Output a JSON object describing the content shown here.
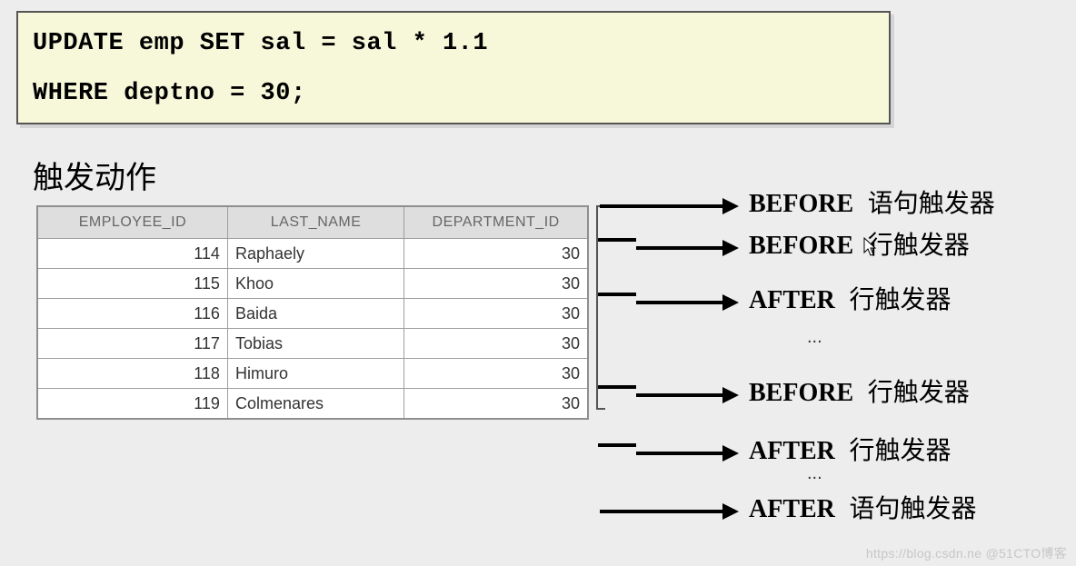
{
  "sql": {
    "line1": "UPDATE emp SET sal = sal * 1.1",
    "line2": "WHERE deptno = 30;"
  },
  "section_title": "触发动作",
  "table": {
    "headers": {
      "c1": "EMPLOYEE_ID",
      "c2": "LAST_NAME",
      "c3": "DEPARTMENT_ID"
    },
    "rows": [
      {
        "id": "114",
        "name": "Raphaely",
        "dept": "30"
      },
      {
        "id": "115",
        "name": "Khoo",
        "dept": "30"
      },
      {
        "id": "116",
        "name": "Baida",
        "dept": "30"
      },
      {
        "id": "117",
        "name": "Tobias",
        "dept": "30"
      },
      {
        "id": "118",
        "name": "Himuro",
        "dept": "30"
      },
      {
        "id": "119",
        "name": "Colmenares",
        "dept": "30"
      }
    ]
  },
  "triggers": [
    {
      "kw": "BEFORE",
      "txt": "语句触发器"
    },
    {
      "kw": "BEFORE",
      "txt": "行触发器"
    },
    {
      "kw": "AFTER",
      "txt": "行触发器"
    },
    {
      "kw": "BEFORE",
      "txt": "行触发器"
    },
    {
      "kw": "AFTER",
      "txt": "行触发器"
    },
    {
      "kw": "AFTER",
      "txt": "语句触发器"
    }
  ],
  "dots": "...",
  "watermark": "https://blog.csdn.ne @51CTO博客"
}
